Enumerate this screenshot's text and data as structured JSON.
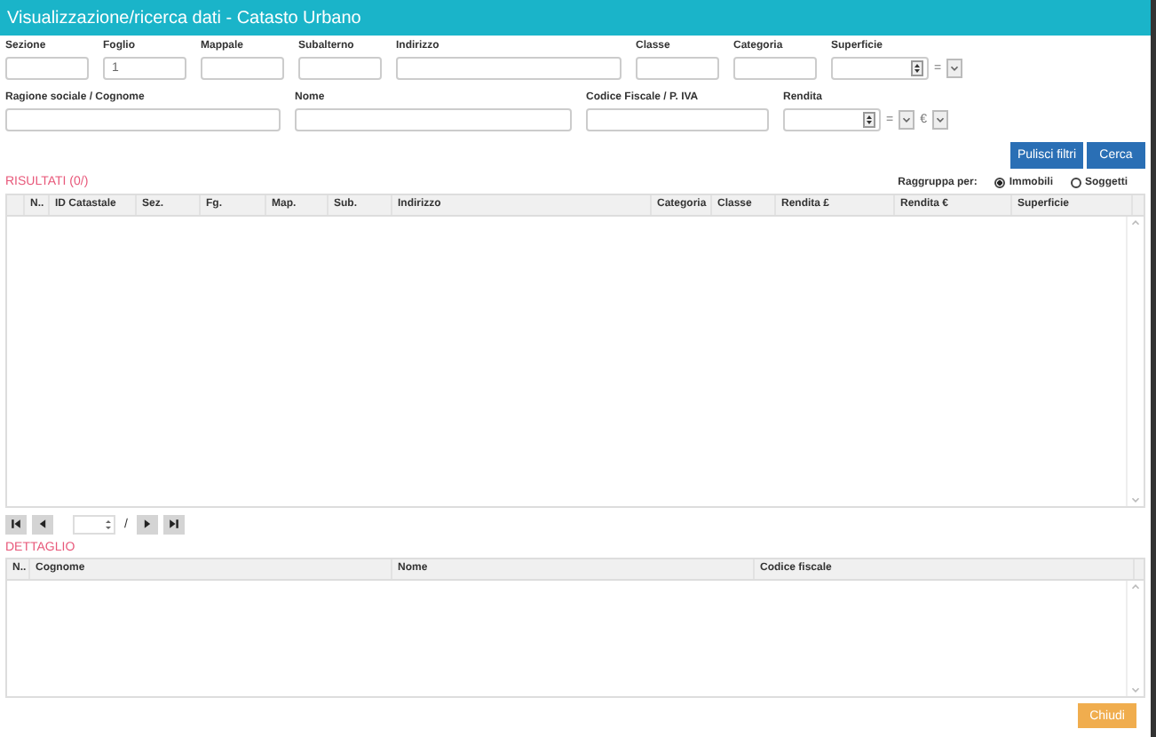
{
  "window": {
    "title": "Visualizzazione/ricerca dati - Catasto Urbano"
  },
  "filter_rows": [
    [
      {
        "label": "Sezione",
        "kind": "text"
      },
      {
        "label": "Foglio",
        "kind": "text",
        "value": "1"
      },
      {
        "label": "Mappale",
        "kind": "text"
      },
      {
        "label": "Subalterno",
        "kind": "text"
      },
      {
        "label": "Indirizzo",
        "kind": "text"
      },
      {
        "label": "Classe",
        "kind": "text"
      },
      {
        "label": "Categoria",
        "kind": "text"
      },
      {
        "label": "Superficie",
        "kind": "range",
        "operator": "="
      }
    ],
    [
      {
        "label": "Ragione sociale / Cognome",
        "kind": "text"
      },
      {
        "label": "Nome",
        "kind": "text"
      },
      {
        "label": "Codice Fiscale / P. IVA",
        "kind": "text"
      },
      {
        "label": "Rendita",
        "kind": "range",
        "operator": "=",
        "currency": "€"
      }
    ]
  ],
  "buttons": [
    {
      "label": "Pulisci filtri"
    },
    {
      "label": "Cerca"
    }
  ],
  "results": {
    "title": "RISULTATI (0/)",
    "group_by": {
      "label": "Raggruppa per:",
      "options": [
        {
          "label": "Immobili",
          "selected": true
        },
        {
          "label": "Soggetti",
          "selected": false
        }
      ]
    },
    "columns": [
      "N..",
      "ID Catastale",
      "Sez.",
      "Fg.",
      "Map.",
      "Sub.",
      "Indirizzo",
      "Categoria",
      "Classe",
      "Rendita £",
      "Rendita €",
      "Superficie"
    ]
  },
  "pager": {
    "separator": "/"
  },
  "detail": {
    "title": "DETTAGLIO",
    "columns": [
      "N..",
      "Cognome",
      "Nome",
      "Codice fiscale"
    ]
  },
  "footer": {
    "button": "Chiudi"
  }
}
